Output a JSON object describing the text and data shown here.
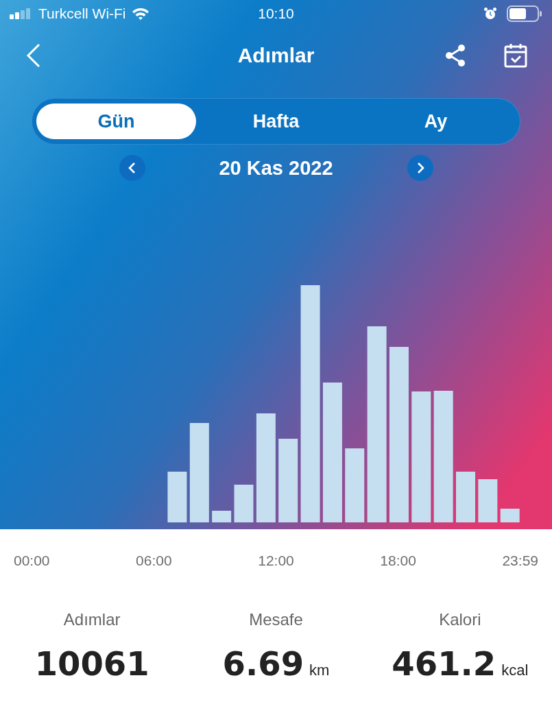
{
  "status_bar": {
    "carrier": "Turkcell Wi-Fi",
    "time": "10:10"
  },
  "header": {
    "title": "Adımlar"
  },
  "tabs": [
    {
      "label": "Gün",
      "selected": true
    },
    {
      "label": "Hafta",
      "selected": false
    },
    {
      "label": "Ay",
      "selected": false
    }
  ],
  "date": "20 Kas 2022",
  "time_axis": [
    "00:00",
    "06:00",
    "12:00",
    "18:00",
    "23:59"
  ],
  "stats": [
    {
      "label": "Adımlar",
      "value": "10061"
    },
    {
      "label": "Mesafe",
      "value": "6.69",
      "unit": "km"
    },
    {
      "label": "Kalori",
      "value": "461.2",
      "unit": "kcal"
    }
  ]
}
